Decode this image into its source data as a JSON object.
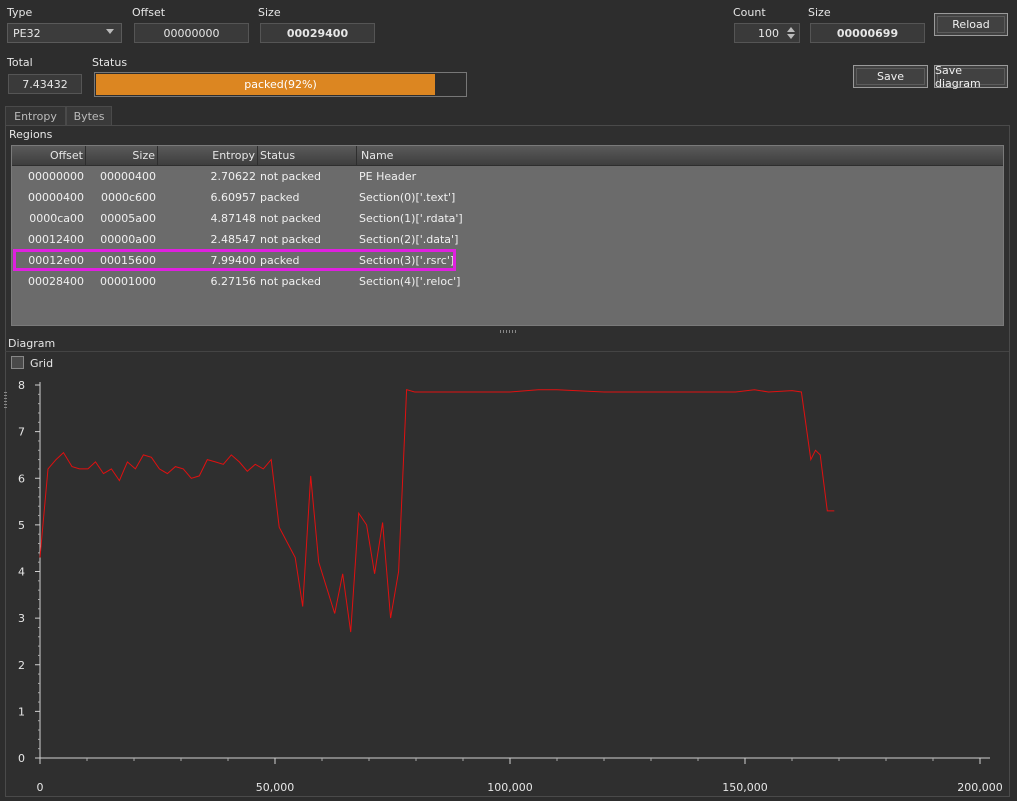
{
  "top": {
    "type_label": "Type",
    "type_value": "PE32",
    "offset_label": "Offset",
    "offset_value": "00000000",
    "size_label": "Size",
    "size_value": "00029400",
    "count_label": "Count",
    "count_value": "100",
    "size2_label": "Size",
    "size2_value": "00000699",
    "reload_label": "Reload",
    "total_label": "Total",
    "total_value": "7.43432",
    "status_label": "Status",
    "status_text": "packed(92%)",
    "status_percent": 92,
    "save_label": "Save",
    "save_diagram_label": "Save diagram"
  },
  "tabs": [
    {
      "label": "Entropy"
    },
    {
      "label": "Bytes"
    }
  ],
  "regions": {
    "title": "Regions",
    "columns": [
      "Offset",
      "Size",
      "Entropy",
      "Status",
      "Name"
    ],
    "rows": [
      {
        "offset": "00000000",
        "size": "00000400",
        "entropy": "2.70622",
        "status": "not packed",
        "name": "PE Header"
      },
      {
        "offset": "00000400",
        "size": "0000c600",
        "entropy": "6.60957",
        "status": "packed",
        "name": "Section(0)['.text']"
      },
      {
        "offset": "0000ca00",
        "size": "00005a00",
        "entropy": "4.87148",
        "status": "not packed",
        "name": "Section(1)['.rdata']"
      },
      {
        "offset": "00012400",
        "size": "00000a00",
        "entropy": "2.48547",
        "status": "not packed",
        "name": "Section(2)['.data']"
      },
      {
        "offset": "00012e00",
        "size": "00015600",
        "entropy": "7.99400",
        "status": "packed",
        "name": "Section(3)['.rsrc']"
      },
      {
        "offset": "00028400",
        "size": "00001000",
        "entropy": "6.27156",
        "status": "not packed",
        "name": "Section(4)['.reloc']"
      }
    ]
  },
  "diagram": {
    "title": "Diagram",
    "grid_label": "Grid",
    "grid_checked": false
  },
  "colors": {
    "accent_orange": "#dc8621",
    "highlight": "#e020e0",
    "line": "#e01010"
  },
  "chart_data": {
    "type": "line",
    "xlim": [
      0,
      200000
    ],
    "ylim": [
      0,
      8
    ],
    "xticks": [
      "0",
      "50,000",
      "100,000",
      "150,000",
      "200,000"
    ],
    "yticks": [
      "0",
      "1",
      "2",
      "3",
      "4",
      "5",
      "6",
      "7",
      "8"
    ],
    "grid": false,
    "series": [
      {
        "x": [
          0,
          1700,
          3400,
          5000,
          6800,
          8400,
          10200,
          11800,
          13500,
          15200,
          16900,
          18600,
          20300,
          22000,
          23700,
          25400,
          27100,
          28800,
          30500,
          32200,
          33900,
          35600,
          37300,
          39000,
          40700,
          42400,
          44100,
          45800,
          47500,
          49200,
          50900,
          54300,
          55900,
          57600,
          59300,
          62700,
          64400,
          66100,
          67800,
          69500,
          71200,
          72900,
          74600,
          76300,
          78000,
          79700,
          81400,
          90000,
          100000,
          106000,
          110000,
          120000,
          130000,
          140000,
          148000,
          152000,
          155000,
          160000,
          162000,
          164000,
          165000,
          166000,
          167500,
          169000
        ],
        "y": [
          4.3,
          6.2,
          6.4,
          6.55,
          6.25,
          6.2,
          6.2,
          6.35,
          6.1,
          6.2,
          5.95,
          6.35,
          6.2,
          6.5,
          6.45,
          6.2,
          6.1,
          6.25,
          6.2,
          6.0,
          6.05,
          6.4,
          6.35,
          6.3,
          6.5,
          6.35,
          6.15,
          6.3,
          6.2,
          6.4,
          4.95,
          4.3,
          3.25,
          6.05,
          4.2,
          3.1,
          3.95,
          2.7,
          5.25,
          5.0,
          3.95,
          5.05,
          3.0,
          4.0,
          7.9,
          7.85,
          7.85,
          7.85,
          7.85,
          7.9,
          7.9,
          7.85,
          7.85,
          7.85,
          7.85,
          7.9,
          7.85,
          7.88,
          7.85,
          6.4,
          6.6,
          6.5,
          5.3,
          5.3
        ]
      }
    ]
  }
}
